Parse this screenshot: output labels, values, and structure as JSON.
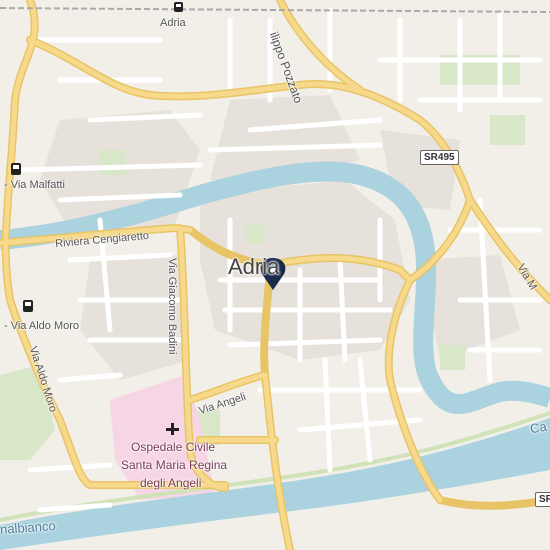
{
  "city": {
    "name": "Adria",
    "station": "Adria"
  },
  "streets": {
    "riviera": "Riviera Cengiaretto",
    "badini": "Via Giacomo Badini",
    "angeli": "Via Angeli",
    "aldo_moro": "Via Aldo Moro",
    "pozzato": "ilippo Pozzato",
    "via_m": "Via M",
    "canal": "nalbianco",
    "canal_right": "Ca"
  },
  "bus_stops": {
    "malfatti": "- Via Malfatti",
    "aldo_moro": "- Via Aldo Moro"
  },
  "road_shields": {
    "sr495": "SR495",
    "sr_edge": "SR"
  },
  "hospital": {
    "line1": "Ospedale Civile",
    "line2": "Santa Maria Regina",
    "line3": "degli Angeli"
  },
  "icons": {
    "pin": "location-pin-icon",
    "bus": "bus-icon",
    "train": "train-icon",
    "hospital": "hospital-cross-icon"
  },
  "colors": {
    "land": "#f2efe9",
    "buildings": "#e4dfd8",
    "water": "#aad3df",
    "major_road": "#f5d576",
    "minor_road": "#ffffff",
    "park": "#d8e8c8",
    "hospital_area": "#f7d6e6",
    "pin": "#1a2a4a"
  }
}
